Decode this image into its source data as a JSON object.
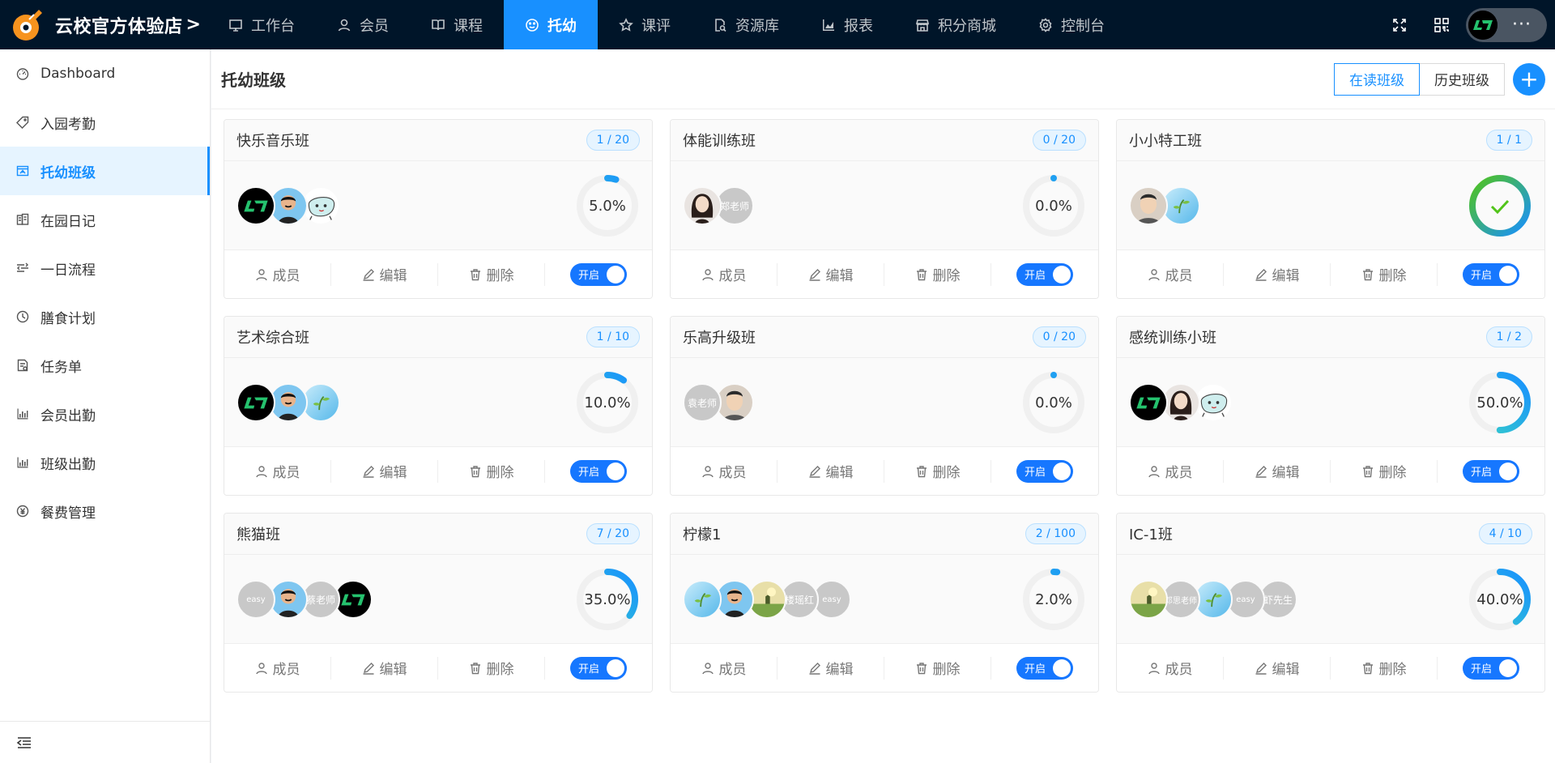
{
  "brand": {
    "name": "云校官方体验店",
    "arrow": ">"
  },
  "nav": [
    {
      "label": "工作台",
      "icon": "desktop-icon"
    },
    {
      "label": "会员",
      "icon": "user-icon"
    },
    {
      "label": "课程",
      "icon": "book-icon"
    },
    {
      "label": "托幼",
      "icon": "smile-icon",
      "active": true
    },
    {
      "label": "课评",
      "icon": "star-icon"
    },
    {
      "label": "资源库",
      "icon": "file-search-icon"
    },
    {
      "label": "报表",
      "icon": "area-chart-icon"
    },
    {
      "label": "积分商城",
      "icon": "shop-icon"
    },
    {
      "label": "控制台",
      "icon": "setting-icon"
    }
  ],
  "topright": {
    "fullscreen_icon": "fullscreen-icon",
    "qrcode_icon": "qrcode-icon",
    "more": "···"
  },
  "sidebar": [
    {
      "label": "Dashboard",
      "icon": "dashboard-icon"
    },
    {
      "label": "入园考勤",
      "icon": "tag-icon"
    },
    {
      "label": "托幼班级",
      "icon": "class-icon",
      "active": true
    },
    {
      "label": "在园日记",
      "icon": "diary-icon"
    },
    {
      "label": "一日流程",
      "icon": "flow-icon"
    },
    {
      "label": "膳食计划",
      "icon": "clock-icon"
    },
    {
      "label": "任务单",
      "icon": "task-icon"
    },
    {
      "label": "会员出勤",
      "icon": "bar-chart-icon"
    },
    {
      "label": "班级出勤",
      "icon": "bar-chart-icon"
    },
    {
      "label": "餐费管理",
      "icon": "yen-icon"
    }
  ],
  "page": {
    "title": "托幼班级",
    "tabs": [
      "在读班级",
      "历史班级"
    ],
    "active_tab": "在读班级",
    "add": "+"
  },
  "actions": {
    "members": "成员",
    "edit": "编辑",
    "delete": "删除",
    "switch": "开启"
  },
  "colors": {
    "accent": "#1890ff",
    "ring_start": "#36cfc9",
    "ring_end": "#1890ff",
    "done_ring": "#52c41a"
  },
  "classes": [
    {
      "name": "快乐音乐班",
      "count": "1 / 20",
      "percent": "5.0%",
      "progress": 0.05,
      "avatars": [
        {
          "type": "logo"
        },
        {
          "type": "man"
        },
        {
          "type": "cartoon"
        }
      ]
    },
    {
      "name": "体能训练班",
      "count": "0 / 20",
      "percent": "0.0%",
      "progress": 0.0,
      "avatars": [
        {
          "type": "woman"
        },
        {
          "type": "text",
          "text": "郑老师"
        }
      ]
    },
    {
      "name": "小小特工班",
      "count": "1 / 1",
      "percent": "",
      "progress": 1.0,
      "done": true,
      "avatars": [
        {
          "type": "man2"
        },
        {
          "type": "plant"
        }
      ]
    },
    {
      "name": "艺术综合班",
      "count": "1 / 10",
      "percent": "10.0%",
      "progress": 0.1,
      "avatars": [
        {
          "type": "logo"
        },
        {
          "type": "man"
        },
        {
          "type": "plant"
        }
      ]
    },
    {
      "name": "乐高升级班",
      "count": "0 / 20",
      "percent": "0.0%",
      "progress": 0.0,
      "avatars": [
        {
          "type": "text",
          "text": "袁老师"
        },
        {
          "type": "man2"
        }
      ]
    },
    {
      "name": "感统训练小班",
      "count": "1 / 2",
      "percent": "50.0%",
      "progress": 0.5,
      "avatars": [
        {
          "type": "logo"
        },
        {
          "type": "woman"
        },
        {
          "type": "cartoon"
        }
      ]
    },
    {
      "name": "熊猫班",
      "count": "7 / 20",
      "percent": "35.0%",
      "progress": 0.35,
      "avatars": [
        {
          "type": "text",
          "text": "easy"
        },
        {
          "type": "man"
        },
        {
          "type": "text",
          "text": "蔡老师"
        },
        {
          "type": "logo"
        }
      ]
    },
    {
      "name": "柠檬1",
      "count": "2 / 100",
      "percent": "2.0%",
      "progress": 0.02,
      "avatars": [
        {
          "type": "plant"
        },
        {
          "type": "man"
        },
        {
          "type": "landscape"
        },
        {
          "type": "text",
          "text": "楼瑶红"
        },
        {
          "type": "text",
          "text": "easy"
        }
      ]
    },
    {
      "name": "IC-1班",
      "count": "4 / 10",
      "percent": "40.0%",
      "progress": 0.4,
      "avatars": [
        {
          "type": "landscape"
        },
        {
          "type": "text",
          "text": "邓思老师"
        },
        {
          "type": "plant"
        },
        {
          "type": "text",
          "text": "easy"
        },
        {
          "type": "text",
          "text": "虾先生"
        }
      ]
    }
  ]
}
